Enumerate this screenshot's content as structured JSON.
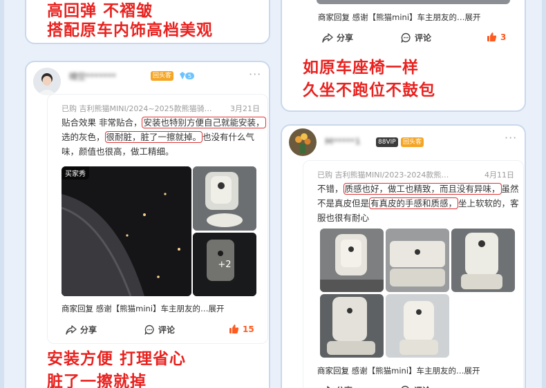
{
  "colors": {
    "accent": "#e8221f",
    "badge_blue": "#4aa3ff",
    "badge_orange": "#f5a524",
    "like": "#ff5a1f"
  },
  "left_top": {
    "line1": "高回弹 不褶皱",
    "line2": "搭配原车内饰高档美观"
  },
  "left_review": {
    "username": "晴空*******",
    "user_badge": "回头客",
    "meta_text": "已购 吉利熊猫MINI/2024~2025款熊猫骑…",
    "date": "3月21日",
    "t1": "贴合效果 非常贴合，",
    "h1": "安装也特别方便自己就能安装，",
    "t2": "选的灰色，",
    "h2": "很耐脏，脏了一擦就掉。",
    "t3": "也没有什么气味，颜值也很高，做工精细。",
    "photo_tag": "买家秀",
    "more_photos": "+2",
    "reply_label": "商家回复",
    "reply_text": "感谢【熊猫mini】车主朋友的…",
    "expand": "展开",
    "share": "分享",
    "comment": "评论",
    "likes": "15"
  },
  "left_bottom": {
    "line1": "安装方便 打理省心",
    "line2": "脏了一擦就掉"
  },
  "right_top_review": {
    "reply_label": "商家回复",
    "reply_text": "感谢【熊猫mini】车主朋友的…",
    "expand": "展开",
    "share": "分享",
    "comment": "评论",
    "likes": "3"
  },
  "right_mid": {
    "line1": "如原车座椅一样",
    "line2": "久坐不跑位不鼓包"
  },
  "right_review": {
    "username": "M*****1",
    "vip": "88VIP",
    "user_badge": "回头客",
    "meta_text": "已购 吉利熊猫MINI/2023-2024款熊…",
    "date": "4月11日",
    "t1": "不错，",
    "h1": "质感也好，做工也精致，而且没有异味，",
    "t2": "虽然不是真皮但是",
    "h2": "有真皮的手感和质感，",
    "t3": "坐上软软的，客服也很有耐心",
    "reply_label": "商家回复",
    "reply_text": "感谢【熊猫mini】车主朋友的…",
    "expand": "展开",
    "share": "分享",
    "comment": "评论"
  }
}
